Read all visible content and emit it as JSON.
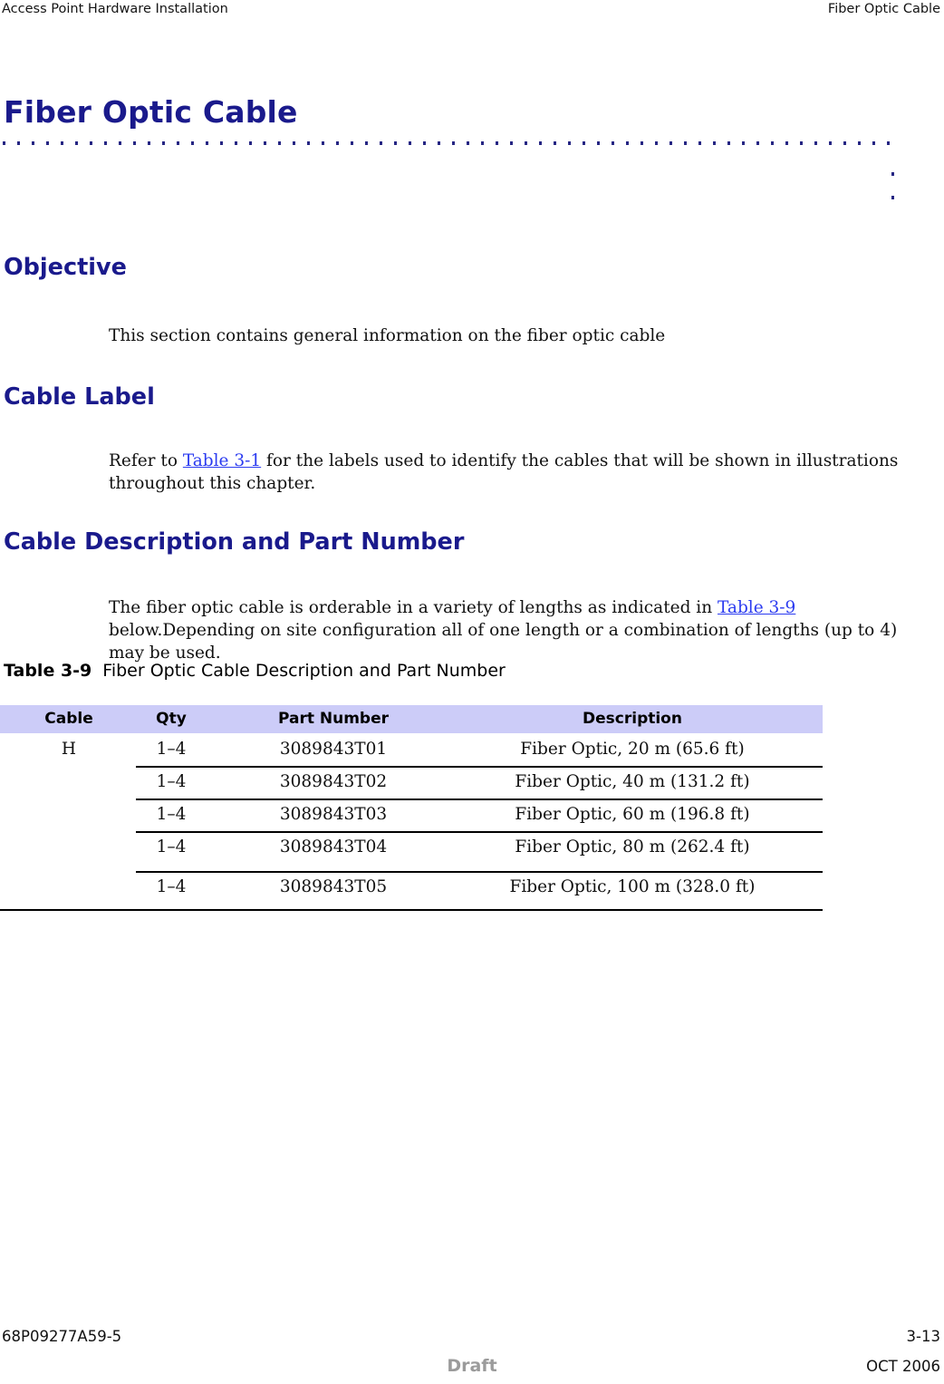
{
  "running_head": {
    "left": "Access Point Hardware Installation",
    "right": "Fiber Optic Cable"
  },
  "chapter": {
    "title": "Fiber Optic Cable"
  },
  "sections": [
    {
      "heading": "Objective",
      "paragraph": "This section contains general information on the fiber optic cable"
    },
    {
      "heading": "Cable Label",
      "paragraph_before_link": "Refer to ",
      "link": "Table 3-1",
      "paragraph_after_link": " for the labels used to identify the cables that will be shown in illustrations throughout this chapter."
    },
    {
      "heading": "Cable Description and Part Number",
      "paragraph_before_link": "The fiber optic cable is orderable in a variety of lengths as indicated in ",
      "link": "Table 3-9",
      "paragraph_after_link": " below.Depending on site configuration all of one length or a combination of lengths (up to 4) may be used."
    }
  ],
  "table": {
    "caption_label": "Table 3-9",
    "caption_text": "Fiber Optic Cable Description and Part Number",
    "header_bg": "#ccccf8",
    "columns": [
      "Cable",
      "Qty",
      "Part Number",
      "Description"
    ],
    "rows": [
      {
        "cable": "H",
        "qty": "1–4",
        "part_number": "3089843T01",
        "description": "Fiber Optic, 20 m (65.6 ft)"
      },
      {
        "cable": "",
        "qty": "1–4",
        "part_number": "3089843T02",
        "description": "Fiber Optic, 40 m (131.2 ft)"
      },
      {
        "cable": "",
        "qty": "1–4",
        "part_number": "3089843T03",
        "description": "Fiber Optic, 60 m (196.8 ft)"
      },
      {
        "cable": "",
        "qty": "1–4",
        "part_number": "3089843T04",
        "description": "Fiber Optic, 80 m (262.4 ft)"
      },
      {
        "cable": "",
        "qty": "1–4",
        "part_number": "3089843T05",
        "description": "Fiber Optic, 100 m (328.0 ft)"
      }
    ]
  },
  "footer": {
    "document_number": "68P09277A59-5",
    "page_number": "3-13",
    "watermark": "Draft",
    "date": "OCT 2006"
  },
  "colors": {
    "heading_blue": "#1a1a8c",
    "link_blue": "#2b3bf0",
    "table_header_bg": "#ccccf8",
    "draft_gray": "#9b9b9b"
  }
}
